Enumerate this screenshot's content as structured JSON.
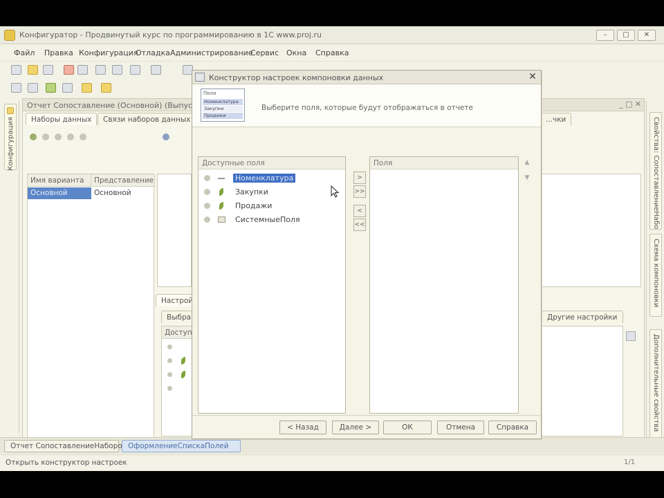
{
  "window": {
    "title": "Конфигуратор - Продвинутый курс по программированию в 1С www.proj.ru"
  },
  "menu": [
    "Файл",
    "Правка",
    "Конфигурация",
    "Отладка",
    "Администрирование",
    "Сервис",
    "Окна",
    "Справка"
  ],
  "left_panel": {
    "label": "Конфигурация"
  },
  "editor": {
    "title": "Отчет Сопоставление (Основной) (Выпуск...)",
    "tabs": [
      "Наборы данных",
      "Связи наборов данных",
      "...чки"
    ],
    "variants_header": [
      "Имя варианта",
      "Представление"
    ],
    "variants_row": [
      "Основной",
      "Основной"
    ],
    "settings_tab": "Настройки",
    "settings_subtab": "Выбранные...",
    "fields_header": "Доступ...",
    "other_settings_tab": "Другие настройки"
  },
  "right_panel": {
    "tabs": [
      "Свойства: СопоставлениеНаборов",
      "Схема компоновки",
      "Дополнительные свойства"
    ]
  },
  "dialog": {
    "title": "Конструктор настроек компоновки данных",
    "preview": {
      "title": "Поля",
      "rows": [
        "Номенклатура",
        "Закупки",
        "Продажи"
      ]
    },
    "hint": "Выберите поля, которые будут отображаться в отчете",
    "available_header": "Доступные поля",
    "selected_header": "Поля",
    "tree": [
      {
        "label": "Номенклатура",
        "selected": true,
        "kind": "dash"
      },
      {
        "label": "Закупки",
        "selected": false,
        "kind": "leaf"
      },
      {
        "label": "Продажи",
        "selected": false,
        "kind": "leaf"
      },
      {
        "label": "СистемныеПоля",
        "selected": false,
        "kind": "folder"
      }
    ],
    "move_buttons": [
      ">",
      ">>",
      "<",
      "<<"
    ],
    "buttons": {
      "back": "< Назад",
      "next": "Далее >",
      "ok": "ОК",
      "cancel": "Отмена",
      "help": "Справка"
    }
  },
  "taskbar": {
    "items": [
      "Отчет СопоставлениеНаборов",
      "ОформлениеСпискаПолей"
    ]
  },
  "status": {
    "text": "Открыть конструктор настроек",
    "position": "1/1"
  },
  "colors": {
    "selection": "#3f6fc4",
    "background": "#f3f2e6"
  }
}
